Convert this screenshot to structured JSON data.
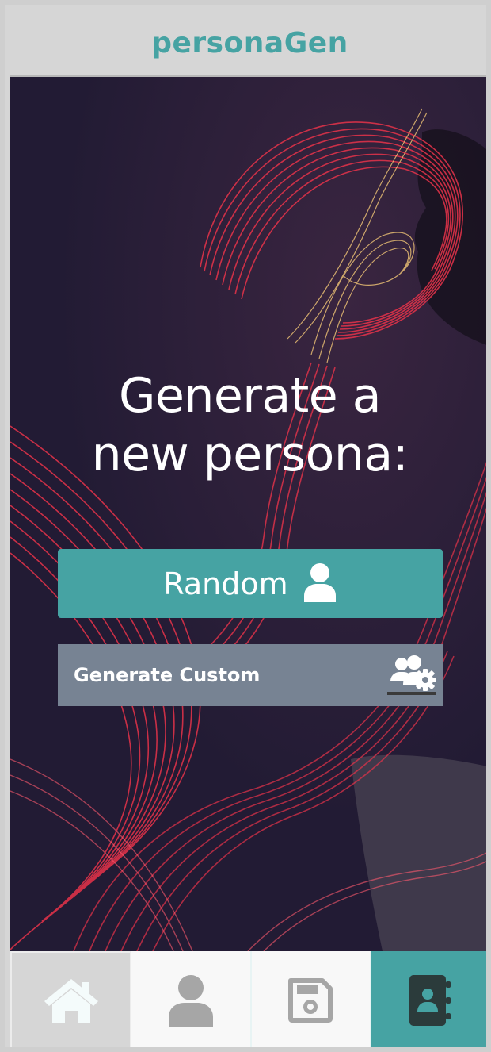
{
  "header": {
    "title": "personaGen"
  },
  "hero": {
    "headline_line1": "Generate a",
    "headline_line2": "new persona:"
  },
  "buttons": {
    "random_label": "Random",
    "random_icon": "user-icon",
    "custom_label": "Generate Custom",
    "custom_icon": "users-gear-icon"
  },
  "navbar": {
    "items": [
      {
        "name": "home",
        "icon": "home-icon",
        "active": false
      },
      {
        "name": "persona",
        "icon": "user-icon",
        "active": false
      },
      {
        "name": "saved",
        "icon": "floppy-disk-icon",
        "active": false
      },
      {
        "name": "contacts",
        "icon": "address-book-icon",
        "active": true
      }
    ]
  },
  "colors": {
    "accent": "#46a3a3",
    "header_bg": "#d6d6d6",
    "hero_bg": "#221b34",
    "custom_button": "#778393",
    "light_trail": "#e8334a"
  }
}
